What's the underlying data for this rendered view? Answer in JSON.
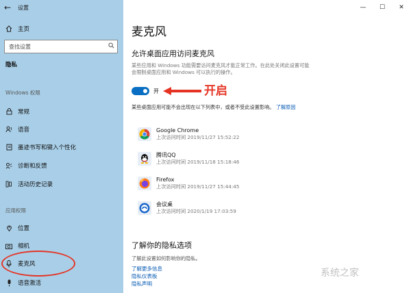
{
  "window": {
    "title": "设置"
  },
  "sidebar": {
    "home": "主页",
    "search_placeholder": "查找设置",
    "privacy_header": "隐私",
    "windows_permissions_header": "Windows 权限",
    "windows_items": [
      {
        "label": "常规"
      },
      {
        "label": "语音"
      },
      {
        "label": "墨迹书写和键入个性化"
      },
      {
        "label": "诊断和反馈"
      },
      {
        "label": "活动历史记录"
      }
    ],
    "app_permissions_header": "应用权限",
    "app_items": [
      {
        "label": "位置"
      },
      {
        "label": "相机"
      },
      {
        "label": "麦克风"
      },
      {
        "label": "语音激活"
      }
    ]
  },
  "main": {
    "title": "麦克风",
    "section_title": "允许桌面应用访问麦克风",
    "section_desc": "某些应用和 Windows 功能需要访问麦克风才能正常工作。在此处关闭此设置可能会限制桌面应用和 Windows 可以执行的操作。",
    "toggle": {
      "state_label": "开",
      "on": true,
      "color": "#0a6fc2"
    },
    "note": "某些桌面应用可能不会出现在以下列表中，或者不受此设置影响。",
    "note_link": "了解原因",
    "apps": [
      {
        "name": "Google Chrome",
        "time": "上次访问时间 2019/11/27 15:52:22",
        "icon": "chrome-icon"
      },
      {
        "name": "腾讯QQ",
        "time": "上次访问时间 2019/11/18 15:18:46",
        "icon": "qq-icon"
      },
      {
        "name": "Firefox",
        "time": "上次访问时间 2019/11/27 15:44:45",
        "icon": "firefox-icon"
      },
      {
        "name": "会议桌",
        "time": "上次访问时间 2020/1/19 17:03:59",
        "icon": "meeting-icon"
      }
    ],
    "privacy_title": "了解你的隐私选项",
    "privacy_desc": "了解此设置如何影响你的隐私。",
    "privacy_links": [
      {
        "label": "了解更多信息"
      },
      {
        "label": "隐私仪表板"
      },
      {
        "label": "隐私声明"
      }
    ]
  },
  "annotation": {
    "text": "开启",
    "color": "#e53323"
  },
  "watermark": "系统之家"
}
